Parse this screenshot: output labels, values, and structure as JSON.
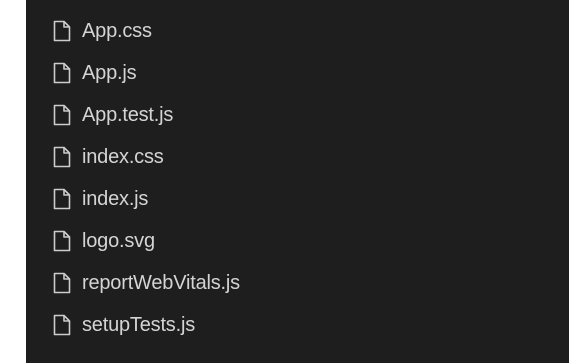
{
  "explorer": {
    "files": [
      {
        "name": "App.css",
        "icon": "file-icon"
      },
      {
        "name": "App.js",
        "icon": "file-icon"
      },
      {
        "name": "App.test.js",
        "icon": "file-icon"
      },
      {
        "name": "index.css",
        "icon": "file-icon"
      },
      {
        "name": "index.js",
        "icon": "file-icon"
      },
      {
        "name": "logo.svg",
        "icon": "file-icon"
      },
      {
        "name": "reportWebVitals.js",
        "icon": "file-icon"
      },
      {
        "name": "setupTests.js",
        "icon": "file-icon"
      }
    ]
  },
  "colors": {
    "background": "#1e1e1e",
    "text": "#d4d4d4",
    "icon": "#cccccc"
  }
}
